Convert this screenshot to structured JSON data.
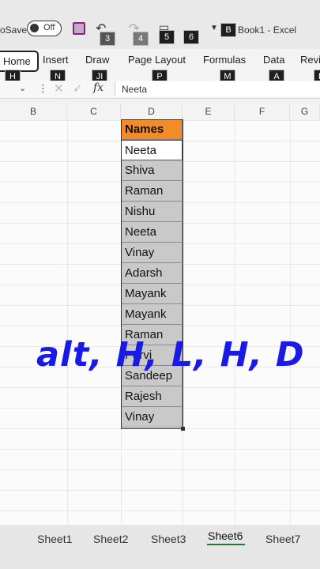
{
  "titlebar": {
    "autosave_label": "oSave",
    "toggle_text": "Off",
    "undo_keytip": "3",
    "redo_keytip": "4",
    "keytip_5": "5",
    "keytip_6": "6",
    "more_keytip": "B",
    "document_title": "Book1  -  Excel"
  },
  "ribbon": {
    "tabs": [
      {
        "label": "Home",
        "keytip": "H"
      },
      {
        "label": "Insert",
        "keytip": "N"
      },
      {
        "label": "Draw",
        "keytip": "JI"
      },
      {
        "label": "Page Layout",
        "keytip": "P"
      },
      {
        "label": "Formulas",
        "keytip": "M"
      },
      {
        "label": "Data",
        "keytip": "A"
      },
      {
        "label": "Revi",
        "keytip": "R"
      }
    ]
  },
  "formula_bar": {
    "fx_label": "fx",
    "value": "Neeta"
  },
  "columns": [
    "B",
    "C",
    "D",
    "E",
    "F",
    "G"
  ],
  "names_table": {
    "header": "Names",
    "header_color": "#f28c28",
    "values": [
      "Neeta",
      "Shiva",
      "Raman",
      "Nishu",
      "Neeta",
      "Vinay",
      "Adarsh",
      "Mayank",
      "Mayank",
      "Raman",
      "Parvi",
      "Sandeep",
      "Rajesh",
      "Vinay"
    ]
  },
  "overlay_text": "alt, H, L, H, D",
  "overlay_color": "#1a1ae6",
  "sheets": [
    "Sheet1",
    "Sheet2",
    "Sheet3",
    "Sheet6",
    "Sheet7"
  ],
  "active_sheet": "Sheet6"
}
